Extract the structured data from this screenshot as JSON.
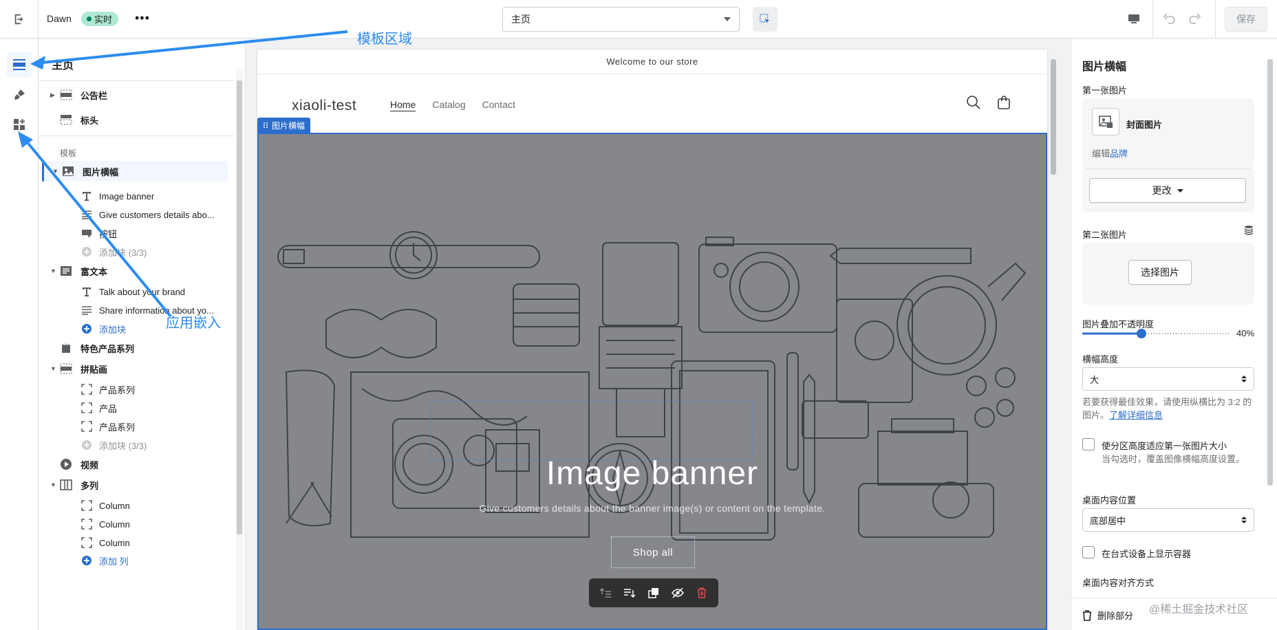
{
  "topbar": {
    "theme_name": "Dawn",
    "live_badge": "实时",
    "more": "•••",
    "page_select": "主页",
    "save_label": "保存"
  },
  "left_panel": {
    "title": "主页",
    "header_sections": [
      {
        "label": "公告栏",
        "icon": "announcement-bar-icon",
        "caret": true
      },
      {
        "label": "标头",
        "icon": "header-icon",
        "caret": false
      }
    ],
    "template_label": "模板",
    "sections": [
      {
        "label": "图片横幅",
        "icon": "image-icon",
        "caret": true,
        "selected": true,
        "blocks": [
          {
            "label": "Image banner",
            "icon": "text-icon"
          },
          {
            "label": "Give customers details abo...",
            "icon": "paragraph-icon"
          },
          {
            "label": "按钮",
            "icon": "button-icon"
          },
          {
            "label": "添加块 (3/3)",
            "icon": "plus-circle-icon",
            "muted": true
          }
        ]
      },
      {
        "label": "富文本",
        "icon": "rich-text-icon",
        "caret": true,
        "blocks": [
          {
            "label": "Talk about your brand",
            "icon": "text-icon"
          },
          {
            "label": "Share information about yo...",
            "icon": "paragraph-icon"
          },
          {
            "label": "添加块",
            "icon": "plus-circle-icon",
            "link": true
          }
        ]
      },
      {
        "label": "特色产品系列",
        "icon": "collection-icon",
        "caret": false,
        "blocks": []
      },
      {
        "label": "拼贴画",
        "icon": "collage-icon",
        "caret": true,
        "blocks": [
          {
            "label": "产品系列",
            "icon": "frame-icon"
          },
          {
            "label": "产品",
            "icon": "frame-icon"
          },
          {
            "label": "产品系列",
            "icon": "frame-icon"
          },
          {
            "label": "添加块 (3/3)",
            "icon": "plus-circle-icon",
            "muted": true
          }
        ]
      },
      {
        "label": "视频",
        "icon": "play-icon",
        "caret": false,
        "blocks": []
      },
      {
        "label": "多列",
        "icon": "columns-icon",
        "caret": true,
        "blocks": [
          {
            "label": "Column",
            "icon": "frame-icon"
          },
          {
            "label": "Column",
            "icon": "frame-icon"
          },
          {
            "label": "Column",
            "icon": "frame-icon"
          },
          {
            "label": "添加 列",
            "icon": "plus-circle-icon",
            "link": true
          }
        ]
      }
    ]
  },
  "preview": {
    "announcement": "Welcome to our store",
    "store_name": "xiaoli-test",
    "nav": [
      "Home",
      "Catalog",
      "Contact"
    ],
    "section_tag": "图片横幅",
    "banner_title": "Image banner",
    "banner_subtitle": "Give customers details about the banner image(s) or content on the template.",
    "banner_button": "Shop all"
  },
  "right_panel": {
    "title": "图片横幅",
    "first_image_label": "第一张图片",
    "first_image_name": "封面图片",
    "edit_brand_prefix": "编辑",
    "edit_brand_link": "品牌",
    "change_button": "更改",
    "second_image_label": "第二张图片",
    "select_image_button": "选择图片",
    "opacity_label": "图片叠加不透明度",
    "opacity_value": "40%",
    "opacity_fraction": 0.4,
    "height_label": "横幅高度",
    "height_value": "大",
    "height_help": "若要获得最佳效果，请使用纵横比为 3:2 的图片。",
    "height_help_link": "了解详细信息",
    "adapt_checkbox": "使分区高度适应第一张图片大小",
    "adapt_help": "当勾选时，覆盖图像横幅高度设置。",
    "position_label": "桌面内容位置",
    "position_value": "底部居中",
    "container_checkbox": "在台式设备上显示容器",
    "alignment_label": "桌面内容对齐方式",
    "delete_label": "删除部分"
  },
  "annotations": {
    "template_area": "模板区域",
    "app_embed": "应用嵌入"
  },
  "watermark": "@稀土掘金技术社区",
  "colors": {
    "accent": "#2c6ecb",
    "annotation": "#2d8cf0",
    "banner_overlay": "#85878b",
    "live_badge": "#aee9d1",
    "delete_icon": "#e0474c"
  }
}
